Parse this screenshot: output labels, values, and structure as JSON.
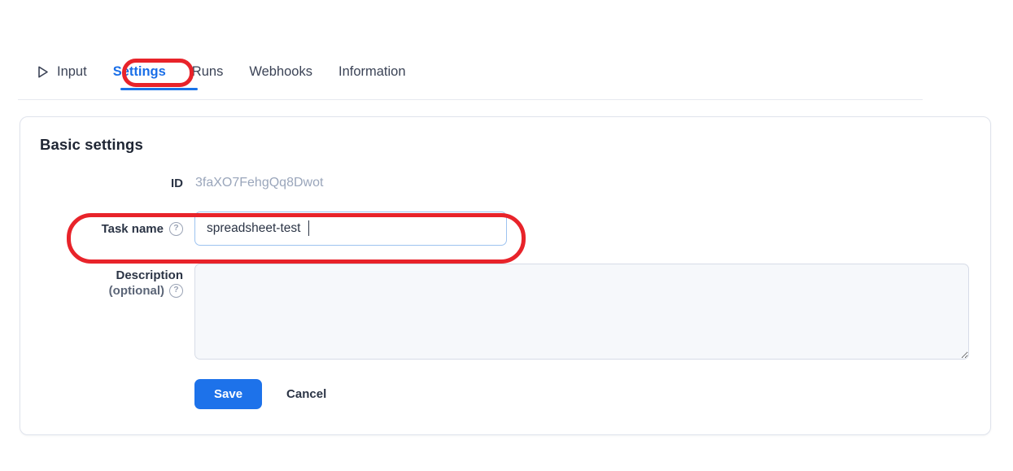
{
  "tabs": [
    {
      "label": "Input",
      "icon": "play-icon",
      "active": false
    },
    {
      "label": "Settings",
      "icon": "",
      "active": true
    },
    {
      "label": "Runs",
      "icon": "",
      "active": false
    },
    {
      "label": "Webhooks",
      "icon": "",
      "active": false
    },
    {
      "label": "Information",
      "icon": "",
      "active": false
    }
  ],
  "card": {
    "title": "Basic settings",
    "fields": {
      "id": {
        "label": "ID",
        "value": "3faXO7FehgQq8Dwot"
      },
      "task_name": {
        "label": "Task name",
        "help_icon": "help-circle-icon",
        "value": "spreadsheet-test",
        "placeholder": ""
      },
      "description": {
        "label": "Description",
        "sublabel": "(optional)",
        "help_icon": "help-circle-icon",
        "value": "",
        "placeholder": ""
      }
    },
    "buttons": {
      "save": "Save",
      "cancel": "Cancel"
    }
  },
  "annotations": [
    {
      "name": "settings-tab-highlight",
      "color": "#e8232a"
    },
    {
      "name": "task-name-row-highlight",
      "color": "#e8232a"
    }
  ],
  "colors": {
    "accent_blue": "#1d72ea",
    "tab_active": "#1a6fe8",
    "annotation_red": "#e8232a",
    "muted_text": "#9aa6bb"
  }
}
